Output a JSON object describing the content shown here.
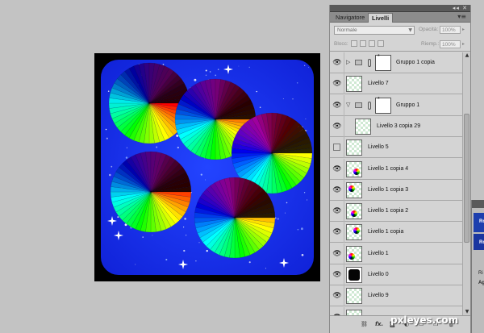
{
  "panel": {
    "tabs": {
      "navigator": "Navigatore",
      "layers": "Livelli",
      "menu_icon": "menu-icon"
    },
    "blend_mode": "Normale",
    "opacity_label": "Opacità:",
    "opacity_value": "100%",
    "lock_label": "Blocc:",
    "fill_label": "Riemp.:",
    "fill_value": "100%"
  },
  "layers": [
    {
      "name": "Gruppo 1 copia",
      "visible": true,
      "kind": "group",
      "expanded": false
    },
    {
      "name": "Livello 7",
      "visible": true,
      "kind": "layer",
      "thumb": "empty"
    },
    {
      "name": "Gruppo 1",
      "visible": true,
      "kind": "group",
      "expanded": true
    },
    {
      "name": "Livello 3 copia 29",
      "visible": true,
      "kind": "layer",
      "thumb": "empty",
      "indent": true
    },
    {
      "name": "Livello 5",
      "visible": false,
      "kind": "layer",
      "thumb": "empty"
    },
    {
      "name": "Livello 1 copia 4",
      "visible": true,
      "kind": "layer",
      "thumb": "wheel"
    },
    {
      "name": "Livello 1 copia 3",
      "visible": true,
      "kind": "layer",
      "thumb": "wheel"
    },
    {
      "name": "Livello 1 copia 2",
      "visible": true,
      "kind": "layer",
      "thumb": "wheel"
    },
    {
      "name": "Livello 1 copia",
      "visible": true,
      "kind": "layer",
      "thumb": "wheel"
    },
    {
      "name": "Livello 1",
      "visible": true,
      "kind": "layer",
      "thumb": "wheel"
    },
    {
      "name": "Livello 0",
      "visible": true,
      "kind": "layer",
      "thumb": "black"
    },
    {
      "name": "Livello 9",
      "visible": true,
      "kind": "layer",
      "thumb": "empty"
    },
    {
      "name": "",
      "visible": true,
      "kind": "layer",
      "thumb": "empty"
    }
  ],
  "bottom_icons": [
    "link-icon",
    "fx-icon",
    "mask-icon",
    "adjustment-icon",
    "folder-icon",
    "new-layer-icon",
    "trash-icon"
  ],
  "bottom_fx": "fx.",
  "side_panel": {
    "label_1": "Ro",
    "label_2": "Ro",
    "label_3": "Ri",
    "label_4": "Ag"
  },
  "artwork": {
    "background": "#1a2ff0",
    "frame": "#000000"
  },
  "watermark": "pxleyes.com"
}
